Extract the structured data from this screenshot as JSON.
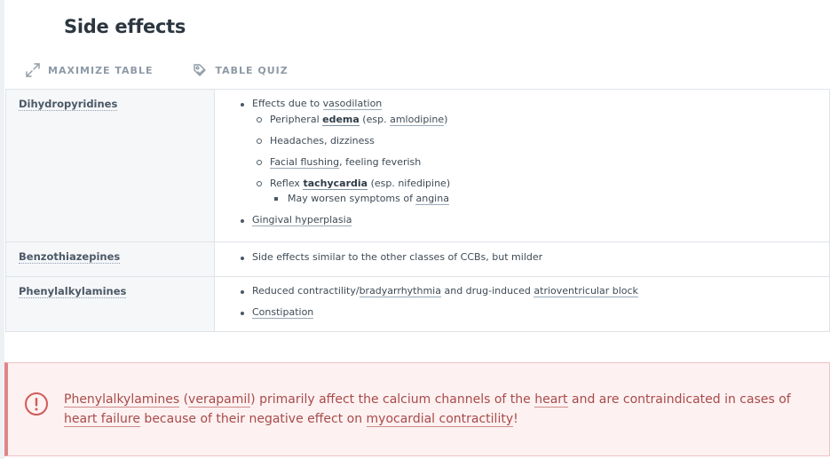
{
  "page": {
    "title": "Side effects"
  },
  "toolbar": {
    "maximize_label": "MAXIMIZE TABLE",
    "quiz_label": "TABLE QUIZ",
    "maximize_icon": "maximize-arrows-icon",
    "quiz_icon": "quiz-tag-icon"
  },
  "table": {
    "rows": [
      {
        "class": "Dihydropyridines",
        "items": [
          {
            "pre": "Effects due to ",
            "link": "vasodilation",
            "post": ""
          },
          {
            "pre": "Peripheral ",
            "link": "edema",
            "mid": " (esp. ",
            "link2": "amlodipine",
            "post": ")"
          },
          {
            "text": "Headaches, dizziness"
          },
          {
            "link": "Facial flushing",
            "post": ", feeling feverish"
          },
          {
            "pre": "Reflex ",
            "link": "tachycardia",
            "post": " (esp. nifedipine)"
          },
          {
            "pre": "May worsen symptoms of ",
            "link": "angina"
          },
          {
            "link": "Gingival hyperplasia"
          }
        ]
      },
      {
        "class": "Benzothiazepines",
        "items": [
          {
            "text": "Side effects similar to the other classes of CCBs, but milder"
          }
        ]
      },
      {
        "class": "Phenylalkylamines",
        "items": [
          {
            "pre": "Reduced contractility/",
            "link": "bradyarrhythmia",
            "mid": " and drug-induced ",
            "link2": "atrioventricular block"
          },
          {
            "link": "Constipation"
          }
        ]
      }
    ]
  },
  "alert": {
    "icon": "exclamation-circle-icon",
    "color": "#a94a4a",
    "s1": "Phenylalkylamines",
    "s2": " (",
    "s3": "verapamil",
    "s4": ") primarily affect the calcium channels of the ",
    "s5": "heart",
    "s6": " and are contraindicated in cases of ",
    "s7": "heart failure",
    "s8": " because of their negative effect on ",
    "s9": "myocardial contractility",
    "s10": "!"
  }
}
